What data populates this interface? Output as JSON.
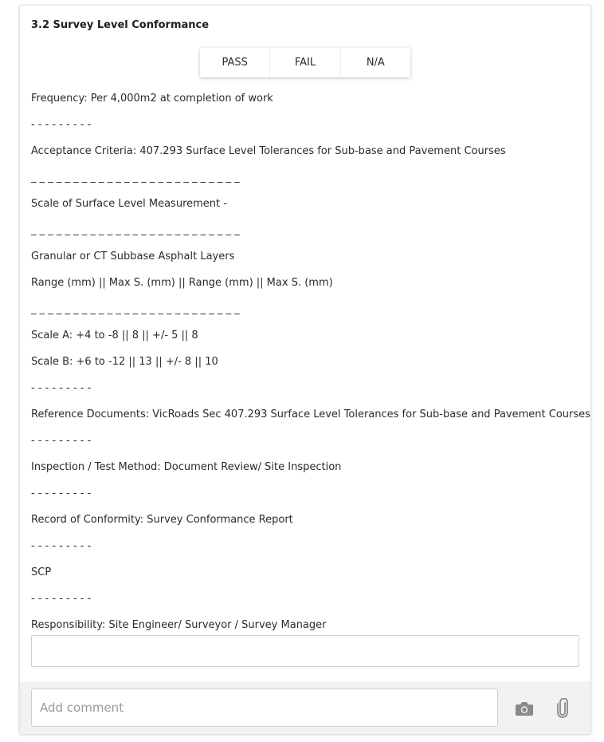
{
  "section": {
    "title": "3.2 Survey Level Conformance"
  },
  "result_options": [
    "PASS",
    "FAIL",
    "N/A"
  ],
  "lines": [
    "Frequency: Per 4,000m2 at completion of work",
    "- - - - - - - - -",
    "Acceptance Criteria: 407.293 Surface Level Tolerances for Sub-base and Pavement Courses",
    "_ _ _ _ _ _ _ _ _ _ _ _ _ _ _ _ _ _ _ _ _ _ _ _ _",
    "Scale of Surface Level Measurement -",
    "_ _ _ _ _ _ _ _ _ _ _ _ _ _ _ _ _ _ _ _ _ _ _ _ _",
    "Granular or CT Subbase Asphalt Layers",
    "Range (mm) || Max S. (mm) || Range (mm) || Max S. (mm)",
    "_ _ _ _ _ _ _ _ _ _ _ _ _ _ _ _ _ _ _ _ _ _ _ _ _",
    "Scale A: +4 to -8 || 8 || +/- 5 || 8",
    "Scale B: +6 to -12 || 13 || +/- 8 || 10",
    "- - - - - - - - -",
    "Reference Documents: VicRoads Sec 407.293 Surface Level Tolerances for Sub-base and Pavement Courses",
    "- - - - - - - - -",
    "Inspection / Test Method: Document Review/ Site Inspection",
    "- - - - - - - - -",
    "Record of Conformity: Survey Conformance Report",
    "- - - - - - - - -",
    "SCP",
    "- - - - - - - - -",
    "Responsibility: Site Engineer/ Surveyor / Survey Manager"
  ],
  "response_input": {
    "value": ""
  },
  "footer": {
    "comment_placeholder": "Add comment",
    "camera_icon": "camera-icon",
    "attach_icon": "paperclip-icon",
    "icon_color": "#8a8a8a"
  }
}
